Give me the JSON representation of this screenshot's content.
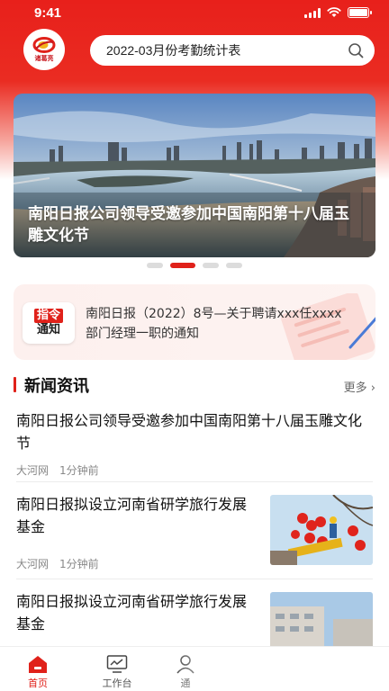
{
  "status_bar": {
    "time": "9:41"
  },
  "logo": {
    "text": "诸葛亮"
  },
  "search": {
    "text": "2022-03月份考勤统计表"
  },
  "banner": {
    "title": "南阳日报公司领导受邀参加中国南阳第十八届玉雕文化节",
    "slide_count": 4,
    "active_slide": 1
  },
  "notice": {
    "badge_top": "指令",
    "badge_bottom": "通知",
    "text": "南阳日报（2022）8号—关于聘请xxx任xxxx部门经理一职的通知"
  },
  "section": {
    "title": "新闻资讯",
    "more": "更多 ›"
  },
  "news": [
    {
      "title": "南阳日报公司领导受邀参加中国南阳第十八届玉雕文化节",
      "source": "大河网",
      "time": "1分钟前"
    },
    {
      "title": "南阳日报拟设立河南省研学旅行发展基金",
      "source": "大河网",
      "time": "1分钟前"
    },
    {
      "title": "南阳日报拟设立河南省研学旅行发展基金"
    }
  ],
  "tabs": [
    {
      "label": "首页",
      "icon": "home-icon",
      "active": true
    },
    {
      "label": "工作台",
      "icon": "monitor-icon",
      "active": false
    },
    {
      "label": "通",
      "icon": "contacts-icon",
      "active": false
    }
  ],
  "colors": {
    "accent": "#e0211a",
    "header": "#e8201b"
  }
}
